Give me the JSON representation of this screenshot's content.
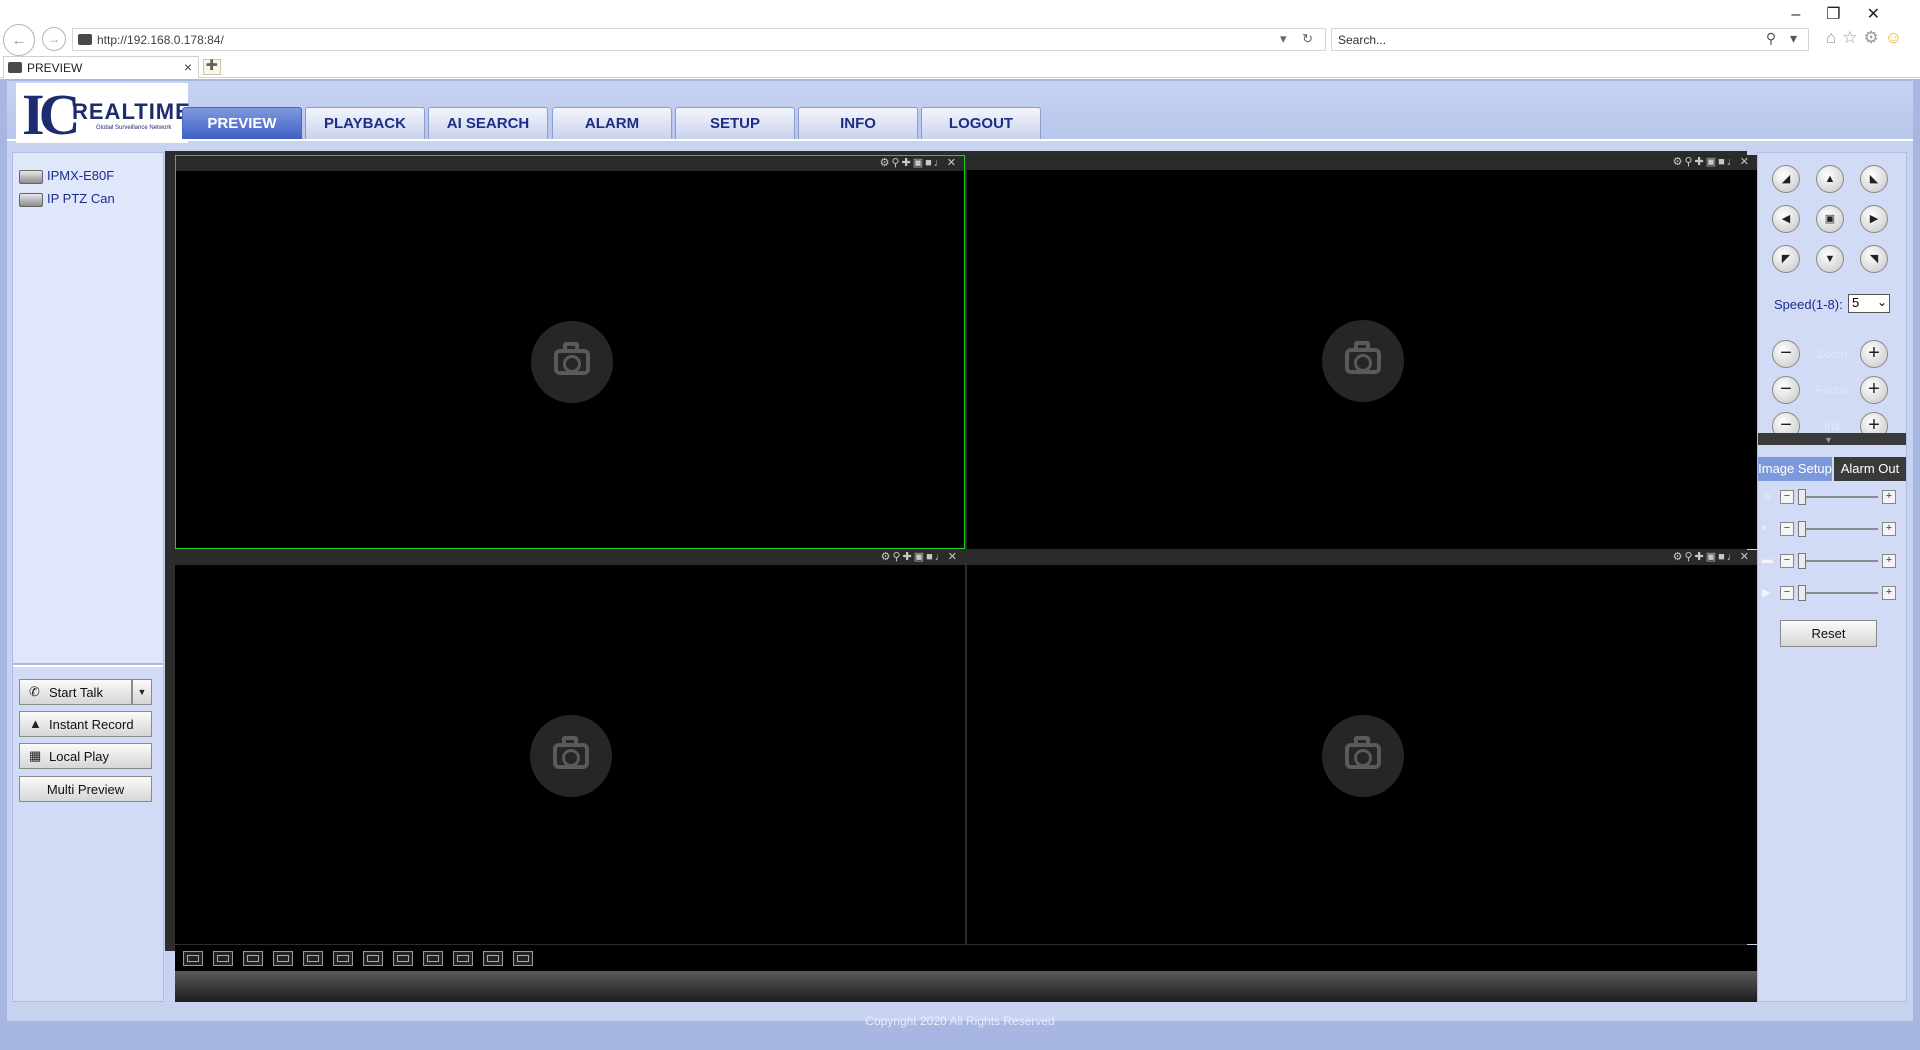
{
  "browser": {
    "url": "http://192.168.0.178:84/",
    "search_placeholder": "Search...",
    "tab_title": "PREVIEW"
  },
  "header": {
    "logo_text": "REALTIME",
    "logo_mark": "IC",
    "logo_tagline": "Global Surveillance Network",
    "nav": [
      {
        "label": "PREVIEW",
        "active": true
      },
      {
        "label": "PLAYBACK"
      },
      {
        "label": "AI SEARCH"
      },
      {
        "label": "ALARM"
      },
      {
        "label": "SETUP"
      },
      {
        "label": "INFO"
      },
      {
        "label": "LOGOUT"
      }
    ]
  },
  "sidebar": {
    "devices": [
      {
        "label": "IPMX-E80F",
        "icon": "camera-device-icon"
      },
      {
        "label": "IP PTZ Can",
        "icon": "camera-device-icon"
      }
    ],
    "tools": {
      "start_talk": "Start Talk",
      "instant_record": "Instant Record",
      "local_play": "Local Play",
      "multi_preview": "Multi Preview"
    }
  },
  "video": {
    "panes": [
      {
        "id": 1,
        "selected": true
      },
      {
        "id": 2,
        "selected": false
      },
      {
        "id": 3,
        "selected": false
      },
      {
        "id": 4,
        "selected": false
      }
    ],
    "pane_toolbar_icons": [
      "microphone-icon",
      "zoom-icon",
      "ptz-icon",
      "snapshot-icon",
      "record-icon",
      "speaker-icon",
      "close-icon"
    ],
    "layout_buttons": [
      "layout-fit-icon",
      "layout-original-icon",
      "layout-wide-icon",
      "fullscreen-icon",
      "layout-strip-icon",
      "layout-1-icon",
      "layout-4-icon",
      "layout-6-icon",
      "layout-8-icon",
      "layout-9-icon",
      "layout-13-icon",
      "layout-16-icon"
    ]
  },
  "ptz": {
    "speed_label": "Speed(1-8):",
    "speed_value": "5",
    "zoom_label": "Zoom",
    "focus_label": "Focus",
    "iris_label": "Iris",
    "tabs": {
      "image_setup": "Image Setup",
      "alarm_out": "Alarm Out"
    },
    "sliders": [
      {
        "icon": "brightness-icon",
        "level": 0.0
      },
      {
        "icon": "contrast-icon",
        "level": 0.0
      },
      {
        "icon": "saturation-icon",
        "level": 0.0
      },
      {
        "icon": "hue-icon",
        "level": 0.0
      }
    ],
    "reset_label": "Reset"
  },
  "footer": {
    "copyright": "Copyright 2020 All Rights Reserved"
  },
  "colors": {
    "accent": "#3e60c4",
    "panel": "#d2dbf5",
    "selected_pane_border": "#22cc22"
  }
}
